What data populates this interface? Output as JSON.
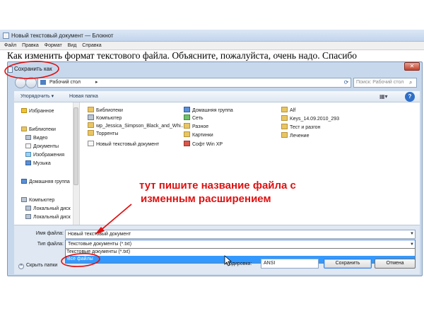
{
  "notepad": {
    "title": "Новый текстовый документ — Блокнот",
    "menu": [
      "Файл",
      "Правка",
      "Формат",
      "Вид",
      "Справка"
    ],
    "text": "Как изменить формат текстового файла. Объясните, пожалуйста, очень надо. Спасибо"
  },
  "dialog": {
    "title": "Сохранить как",
    "close": "✕",
    "address": "Рабочий стол",
    "search_placeholder": "Поиск: Рабочий стол",
    "toolbar": {
      "organize": "Упорядочить ▾",
      "new_folder": "Новая папка"
    },
    "nav": [
      {
        "label": "Избранное",
        "icon": "star-icon"
      },
      {
        "label": "Библиотеки",
        "icon": "library-icon"
      },
      {
        "label": "Видео",
        "icon": "video-icon"
      },
      {
        "label": "Документы",
        "icon": "documents-icon"
      },
      {
        "label": "Изображения",
        "icon": "images-icon"
      },
      {
        "label": "Музыка",
        "icon": "music-icon"
      },
      {
        "label": "Домашняя группа",
        "icon": "homegroup-icon"
      },
      {
        "label": "Компьютер",
        "icon": "computer-icon"
      },
      {
        "label": "Локальный диск",
        "icon": "disk-icon"
      },
      {
        "label": "Локальный диск",
        "icon": "disk-icon"
      }
    ],
    "items": [
      {
        "label": "Библиотеки",
        "icon": "library-icon"
      },
      {
        "label": "Компьютер",
        "icon": "computer-icon"
      },
      {
        "label": "wp_Jessica_Simpson_Black_and_Whi...",
        "icon": "folder-icon"
      },
      {
        "label": "Торренты",
        "icon": "folder-icon"
      },
      {
        "label": "Новый текстовый документ",
        "icon": "text-file-icon"
      },
      {
        "label": "Домашняя группа",
        "icon": "homegroup-icon"
      },
      {
        "label": "Сеть",
        "icon": "network-icon"
      },
      {
        "label": "Разное",
        "icon": "folder-icon"
      },
      {
        "label": "Картинки",
        "icon": "folder-icon"
      },
      {
        "label": "Софт Win XP",
        "icon": "shortcut-icon"
      },
      {
        "label": "Alf",
        "icon": "folder-icon"
      },
      {
        "label": "Keys_14.09.2010_293",
        "icon": "folder-icon"
      },
      {
        "label": "Тест и разгон",
        "icon": "folder-icon"
      },
      {
        "label": "Лечение",
        "icon": "folder-icon"
      }
    ],
    "annotation": [
      "тут пишите название файла с",
      "изменным расширением"
    ],
    "filename_label": "Имя файла:",
    "filename_value": "Новый текстовый документ",
    "filetype_label": "Тип файла:",
    "filetype_value": "Текстовые документы (*.txt)",
    "filetype_options": [
      "Текстовые документы (*.txt)",
      "Все файлы"
    ],
    "hide_folders": "Скрыть папки",
    "encoding_label": "Кодировка:",
    "encoding_value": "ANSI",
    "save_button": "Сохранить",
    "cancel_button": "Отмена"
  },
  "colors": {
    "annotation_red": "#e01010",
    "selection_blue": "#3399ff"
  }
}
